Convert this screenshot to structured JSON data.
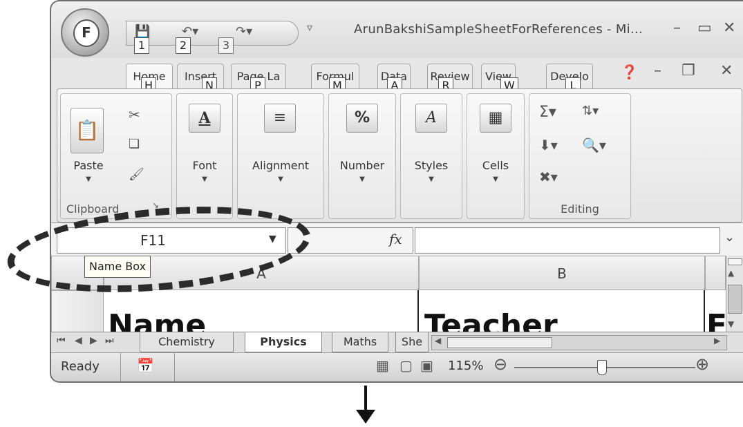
{
  "window": {
    "title": "ArunBakshiSampleSheetForReferences - Mi...",
    "office_button_label": "F",
    "qat_keytips": [
      "1",
      "2",
      "3"
    ]
  },
  "tabs": [
    {
      "label": "Home",
      "keytip": "H"
    },
    {
      "label": "Insert",
      "keytip": "N"
    },
    {
      "label": "Page La",
      "keytip": "P"
    },
    {
      "label": "Formul",
      "keytip": "M"
    },
    {
      "label": "Data",
      "keytip": "A"
    },
    {
      "label": "Review",
      "keytip": "R"
    },
    {
      "label": "View",
      "keytip": "W"
    },
    {
      "label": "Develo",
      "keytip": "L"
    }
  ],
  "ribbon": {
    "clipboard": {
      "group_label": "Clipboard",
      "paste_label": "Paste"
    },
    "font_label": "Font",
    "alignment_label": "Alignment",
    "number_label": "Number",
    "styles_label": "Styles",
    "cells_label": "Cells",
    "editing_label": "Editing"
  },
  "formula_bar": {
    "name_box_value": "F11",
    "fx_label": "fx",
    "formula_value": ""
  },
  "tooltip": {
    "text": "Name Box"
  },
  "grid": {
    "columns": [
      "A",
      "B"
    ],
    "cells": {
      "a1": "Name",
      "b1": "Teacher",
      "c1": "F"
    }
  },
  "sheet_tabs": {
    "tabs": [
      "Chemistry",
      "Physics",
      "Maths",
      "She"
    ],
    "active": "Physics"
  },
  "status": {
    "ready": "Ready",
    "zoom": "115%"
  }
}
